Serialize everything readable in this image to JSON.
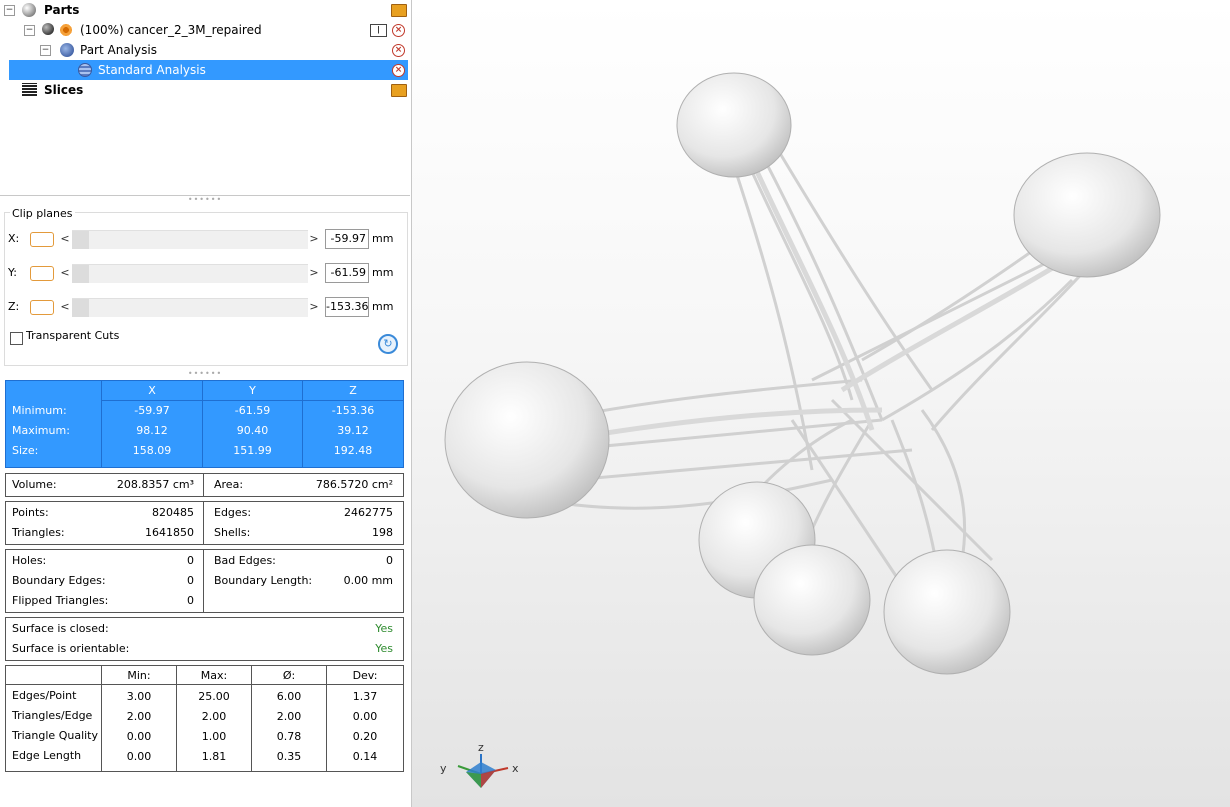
{
  "tree": {
    "items": [
      {
        "label": "Parts"
      },
      {
        "label": "(100%) cancer_2_3M_repaired"
      },
      {
        "label": "Part Analysis"
      },
      {
        "label": "Standard Analysis"
      },
      {
        "label": "Slices"
      }
    ]
  },
  "clip_planes": {
    "title": "Clip planes",
    "rows": [
      {
        "axis": "X:",
        "value": "-59.97",
        "unit": "mm"
      },
      {
        "axis": "Y:",
        "value": "-61.59",
        "unit": "mm"
      },
      {
        "axis": "Z:",
        "value": "-153.36",
        "unit": "mm"
      }
    ],
    "left_arrow": "<",
    "right_arrow": ">",
    "transparent_cuts_label": "Transparent Cuts",
    "transparent_cuts_checked": false
  },
  "bounds": {
    "headers": [
      "X",
      "Y",
      "Z"
    ],
    "rows": [
      {
        "label": "Minimum:",
        "x": "-59.97",
        "y": "-61.59",
        "z": "-153.36"
      },
      {
        "label": "Maximum:",
        "x": "98.12",
        "y": "90.40",
        "z": "39.12"
      },
      {
        "label": "Size:",
        "x": "158.09",
        "y": "151.99",
        "z": "192.48"
      }
    ]
  },
  "volume_area": {
    "volume_label": "Volume:",
    "volume_value": "208.8357 cm³",
    "area_label": "Area:",
    "area_value": "786.5720 cm²"
  },
  "counts": {
    "points_label": "Points:",
    "points_value": "820485",
    "triangles_label": "Triangles:",
    "triangles_value": "1641850",
    "edges_label": "Edges:",
    "edges_value": "2462775",
    "shells_label": "Shells:",
    "shells_value": "198"
  },
  "errors": {
    "holes_label": "Holes:",
    "holes_value": "0",
    "boundary_edges_label": "Boundary Edges:",
    "boundary_edges_value": "0",
    "flipped_label": "Flipped Triangles:",
    "flipped_value": "0",
    "bad_edges_label": "Bad Edges:",
    "bad_edges_value": "0",
    "boundary_length_label": "Boundary Length:",
    "boundary_length_value": "0.00 mm"
  },
  "surface": {
    "closed_label": "Surface is closed:",
    "closed_value": "Yes",
    "orientable_label": "Surface is orientable:",
    "orientable_value": "Yes",
    "ok_color": "#2e8b2e"
  },
  "quality": {
    "headers": [
      "Min:",
      "Max:",
      "Ø:",
      "Dev:"
    ],
    "rows": [
      {
        "label": "Edges/Point",
        "values": [
          "3.00",
          "25.00",
          "6.00",
          "1.37"
        ]
      },
      {
        "label": "Triangles/Edge",
        "values": [
          "2.00",
          "2.00",
          "2.00",
          "0.00"
        ]
      },
      {
        "label": "Triangle Quality",
        "values": [
          "0.00",
          "1.00",
          "0.78",
          "0.20"
        ]
      },
      {
        "label": "Edge Length",
        "values": [
          "0.00",
          "1.81",
          "0.35",
          "0.14"
        ]
      }
    ]
  },
  "axes": {
    "x": "x",
    "y": "y",
    "z": "z"
  },
  "colors": {
    "selection": "#3399ff",
    "accent": "#e39a3b"
  }
}
